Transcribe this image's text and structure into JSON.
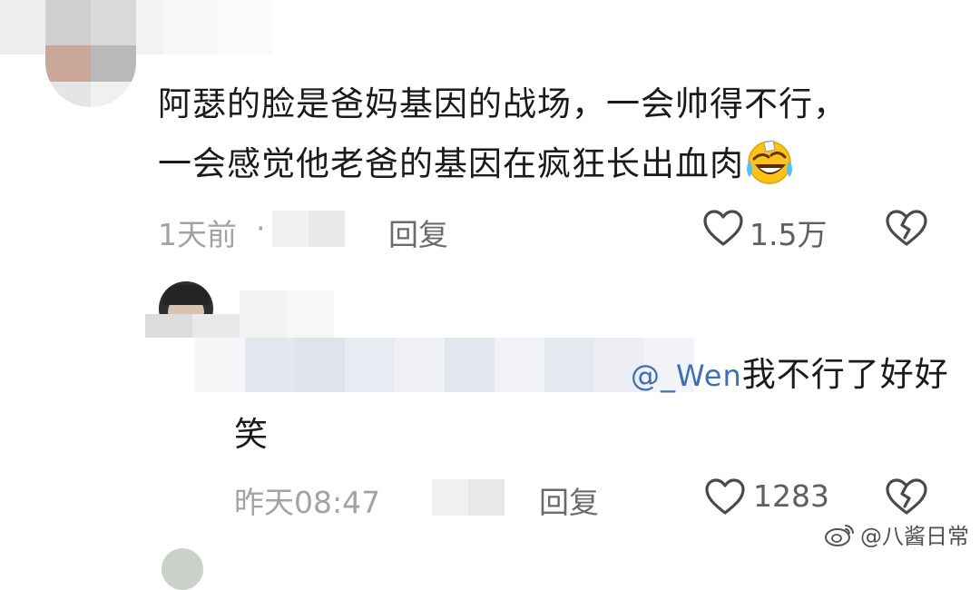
{
  "comments": [
    {
      "text_line1": "阿瑟的脸是爸妈基因的战场，一会帅得不行，",
      "text_line2": "一会感觉他老爸的基因在疯狂长出血肉",
      "emoji": "laughing-crying-face",
      "time": "1天前",
      "dot": "·",
      "reply_label": "回复",
      "like_count": "1.5万"
    },
    {
      "mention": "@_Wen",
      "text_tail": "我不行了好好",
      "text_line2": "笑",
      "time": "昨天08:47",
      "reply_label": "回复",
      "like_count": "1283"
    }
  ],
  "watermark": {
    "icon": "weibo-logo-icon",
    "text": "@八酱日常"
  },
  "colors": {
    "text": "#1a1a1a",
    "meta": "#a3a3a3",
    "mention": "#3d6fb6",
    "icon": "#4a4a4a"
  }
}
